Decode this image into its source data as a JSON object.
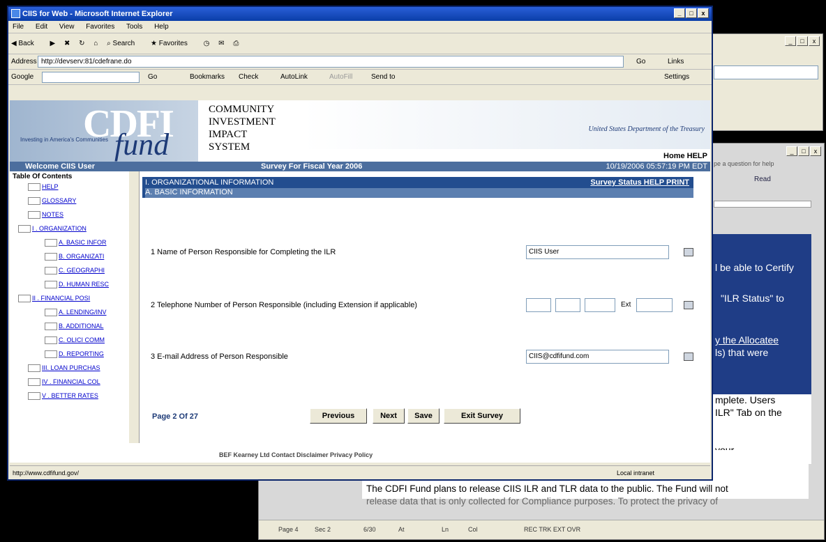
{
  "bgwin1": {
    "buttons": [
      "_",
      "□",
      "x"
    ]
  },
  "word": {
    "help_placeholder": "pe a question for help",
    "read_label": "Read",
    "blue_lines": [
      "l be able to Certify",
      "\"ILR Status\" to",
      "y the Allocatee",
      "ls) that were"
    ],
    "white_lines": [
      "mplete.  Users",
      "ILR\" Tab on the",
      "your"
    ],
    "doc_text_1": "The CDFI Fund plans to release CIIS ILR and TLR data to the public. The Fund will not",
    "doc_text_2": "release data that is only collected for Compliance purposes. To protect the privacy of",
    "status": {
      "page": "Page 4",
      "sec": "Sec 2",
      "pos": "6/30",
      "at": "At",
      "ln": "Ln",
      "col": "Col",
      "flags": "REC  TRK  EXT  OVR"
    }
  },
  "ie": {
    "title": "CIIS for Web - Microsoft Internet Explorer",
    "menu": [
      "File",
      "Edit",
      "View",
      "Favorites",
      "Tools",
      "Help"
    ],
    "toolbar": [
      "Back",
      "Search",
      "Favorites"
    ],
    "address_label": "Address",
    "address": "http://devserv:81/cdefrane.do",
    "go": "Go",
    "links": "Links",
    "google": [
      "Google",
      "Go",
      "Bookmarks",
      "Check",
      "AutoLink",
      "AutoFill",
      "Send to",
      "Settings"
    ],
    "status_url": "http://www.cdfifund.gov/",
    "zone": "Local intranet"
  },
  "banner": {
    "cdfi": "CDFI",
    "fund": "fund",
    "tagline": "Investing in America's Communities",
    "system_lines": [
      "COMMUNITY",
      "INVESTMENT",
      "IMPACT",
      "SYSTEM"
    ],
    "treasury": "United States Department of the Treasury",
    "home_help": "Home HELP"
  },
  "welcome": {
    "user": "Welcome CIIS User",
    "survey": "Survey For Fiscal Year 2006",
    "timestamp": "10/19/2006 05:57:19 PM EDT"
  },
  "toc": {
    "title": "Table Of Contents",
    "items": [
      "HELP",
      "GLOSSARY",
      "NOTES",
      "I . ORGANIZATION",
      "A. BASIC INFOR",
      "B. ORGANIZATI",
      "C. GEOGRAPHI",
      "D. HUMAN RESC",
      "II . FINANCIAL POSI",
      "A. LENDING/INV",
      "B. ADDITIONAL",
      "C. OLICI COMM",
      "D. REPORTING",
      "III. LOAN PURCHAS",
      "IV . FINANCIAL COL",
      "V . BETTER RATES"
    ]
  },
  "section": {
    "title": "I. ORGANIZATIONAL INFORMATION",
    "subtitle": "A. BASIC INFORMATION",
    "links": [
      "Survey Status",
      "HELP",
      "PRINT"
    ]
  },
  "questions": [
    {
      "label": "1 Name of Person Responsible for Completing the ILR",
      "value": "CIIS User"
    },
    {
      "label": "2 Telephone Number of Person Responsible (including Extension if applicable)",
      "ext": "Ext"
    },
    {
      "label": "3 E-mail Address of Person Responsible",
      "value": "CIIS@cdfifund.com"
    }
  ],
  "pager": "Page 2 Of 27",
  "buttons": [
    "Previous",
    "Next",
    "Save",
    "Exit Survey"
  ],
  "footer": "BEF Kearney Ltd   Contact   Disclaimer   Privacy Policy"
}
